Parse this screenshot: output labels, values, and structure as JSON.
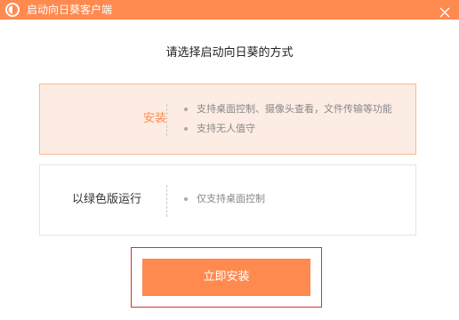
{
  "window": {
    "title": "启动向日葵客户端",
    "logo_icon": "sunlogin-logo-icon",
    "close_icon": "close-icon",
    "accent_color": "#ff8a4f"
  },
  "heading": "请选择启动向日葵的方式",
  "options": [
    {
      "label": "安装",
      "selected": true,
      "features": [
        "支持桌面控制、摄像头查看，文件传输等功能",
        "支持无人值守"
      ]
    },
    {
      "label": "以绿色版运行",
      "selected": false,
      "features": [
        "仅支持桌面控制"
      ]
    }
  ],
  "primary_button": {
    "label": "立即安装"
  }
}
